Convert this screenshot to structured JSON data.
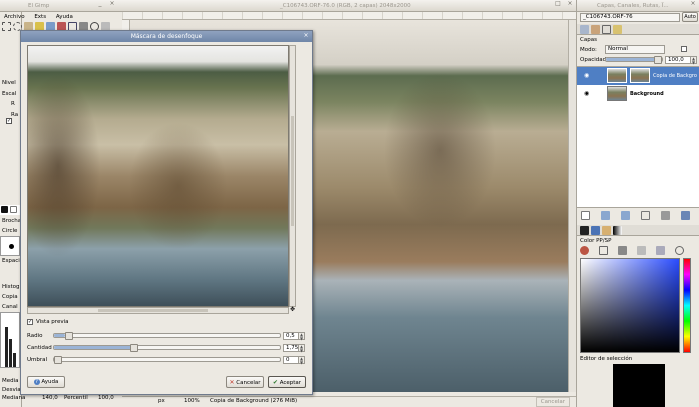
{
  "gimp_toolbox": {
    "title": "El Gimp",
    "menu": [
      "Archivo",
      "Exts",
      "Ayuda"
    ],
    "side_labels": [
      "Nivel",
      "Escal",
      "R",
      "Ra",
      "Espaci",
      "Brocha",
      "Circle",
      "Histogr",
      "Copia",
      "Canal"
    ],
    "bottom_labels": [
      "Media",
      "Desvia",
      "Mediana"
    ],
    "bottom_values": [
      "140,0",
      "Percentil",
      "100,0"
    ]
  },
  "image_window": {
    "title": "_C106743.ORF-76.0 (RGB, 2 capas) 2048x2000",
    "status": {
      "unit": "px",
      "zoom": "100%",
      "info": "Copia de Background (276 MiB)",
      "cancel": "Cancelar"
    }
  },
  "dialog": {
    "title": "Máscara de desenfoque",
    "preview_label": "Vista previa",
    "params": [
      {
        "label": "Radio",
        "value": "0,5",
        "fraction": 0.05
      },
      {
        "label": "Cantidad",
        "value": "1,75",
        "fraction": 0.35
      },
      {
        "label": "Umbral",
        "value": "0",
        "fraction": 0.0
      }
    ],
    "help_button": "Ayuda",
    "cancel_button": "Cancelar",
    "accept_button": "Aceptar"
  },
  "layers_dock": {
    "title": "Capas, Canales, Rutas, Ï...",
    "image_select": "_C106743.ORF-76",
    "auto_button": "Auto",
    "layers_label": "Capas",
    "mode_label": "Modo:",
    "mode_value": "Normal",
    "opacity_label": "Opacidad",
    "opacity_value": "100,0",
    "opacity_fraction": 1.0,
    "layers": [
      {
        "name": "Copia de Backgro",
        "selected": true
      },
      {
        "name": "Background",
        "selected": false
      }
    ],
    "color_label": "Color PP/SP",
    "selection_editor_label": "Editor de selección"
  },
  "colors": {
    "accent": "#5b86c7",
    "layer_selected": "#4f7fc4"
  }
}
